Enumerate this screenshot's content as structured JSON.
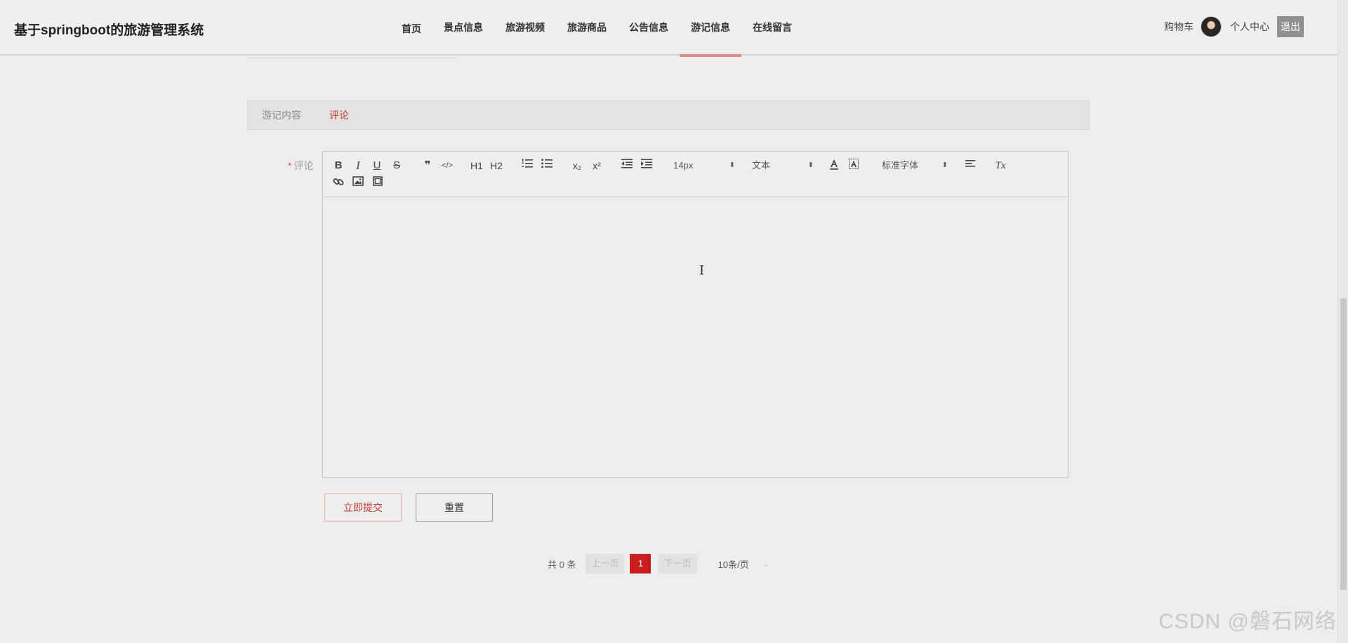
{
  "header": {
    "site_title": "基于springboot的旅游管理系统",
    "nav": [
      {
        "label": "首页"
      },
      {
        "label": "景点信息"
      },
      {
        "label": "旅游视频"
      },
      {
        "label": "旅游商品"
      },
      {
        "label": "公告信息"
      },
      {
        "label": "游记信息",
        "active": true
      },
      {
        "label": "在线留言"
      }
    ],
    "cart_label": "购物车",
    "user_center_label": "个人中心",
    "logout_label": "退出"
  },
  "tabs": [
    {
      "label": "游记内容"
    },
    {
      "label": "评论",
      "active": true
    }
  ],
  "form": {
    "required_mark": "*",
    "comment_label": "评论",
    "toolbar": {
      "bold": "B",
      "italic": "I",
      "underline": "U",
      "strike": "S",
      "quote": "❞",
      "code": "</>",
      "h1": "H1",
      "h2": "H2",
      "sub": "x₂",
      "sup": "x²",
      "size_value": "14px",
      "format_value": "文本",
      "font_value": "标准字体",
      "clear_format": "Tx"
    }
  },
  "buttons": {
    "submit_label": "立即提交",
    "reset_label": "重置"
  },
  "pagination": {
    "total_text": "共 0 条",
    "prev_label": "上一页",
    "current_page": "1",
    "next_label": "下一页",
    "page_size_label": "10条/页"
  },
  "watermark": "CSDN @磐石网络",
  "colors": {
    "accent": "#c9201f",
    "nav_underline": "#e08c8c",
    "background": "#efeeee"
  }
}
